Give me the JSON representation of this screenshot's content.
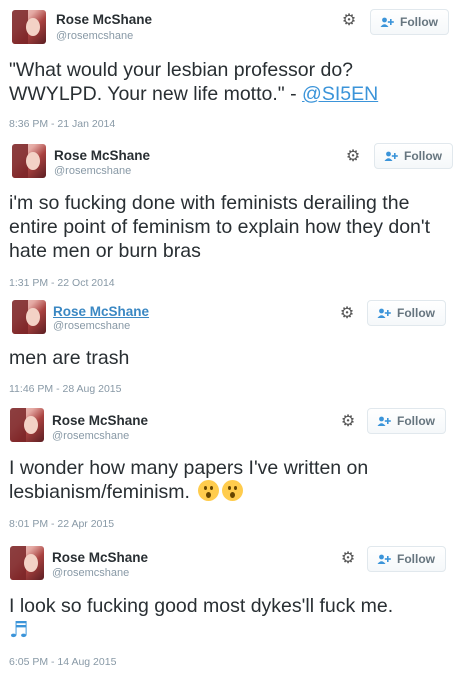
{
  "tweets": [
    {
      "name": "Rose McShane",
      "handle": "@rosemcshane",
      "follow": "Follow",
      "text_before": "\"What would your lesbian professor do? WWYLPD. Your new life motto.\" - ",
      "mention": "@SI5EN",
      "timestamp": "8:36 PM - 21 Jan 2014"
    },
    {
      "name": "Rose McShane",
      "handle": "@rosemcshane",
      "follow": "Follow",
      "text": "i'm so fucking done with feminists derailing the entire point of feminism to explain how they don't hate men or burn bras",
      "timestamp": "1:31 PM - 22 Oct 2014"
    },
    {
      "name": "Rose McShane",
      "handle": "@rosemcshane",
      "follow": "Follow",
      "text": "men are trash",
      "timestamp": "11:46 PM - 28 Aug 2015"
    },
    {
      "name": "Rose McShane",
      "handle": "@rosemcshane",
      "follow": "Follow",
      "text": "I wonder how many papers I've written on lesbianism/feminism.",
      "timestamp": "8:01 PM - 22 Apr 2015"
    },
    {
      "name": "Rose McShane",
      "handle": "@rosemcshane",
      "follow": "Follow",
      "text": "I look so fucking good most dykes'll fuck me.",
      "notes": "♬",
      "timestamp": "6:05 PM - 14 Aug 2015"
    }
  ],
  "icons": {
    "gear": "gear-icon",
    "follow": "add-user-icon",
    "emoji": "astonished-face-emoji",
    "notes": "musical-notes-emoji"
  },
  "colors": {
    "link": "#3b94d9",
    "meta": "#8899a6",
    "text": "#292f33"
  }
}
